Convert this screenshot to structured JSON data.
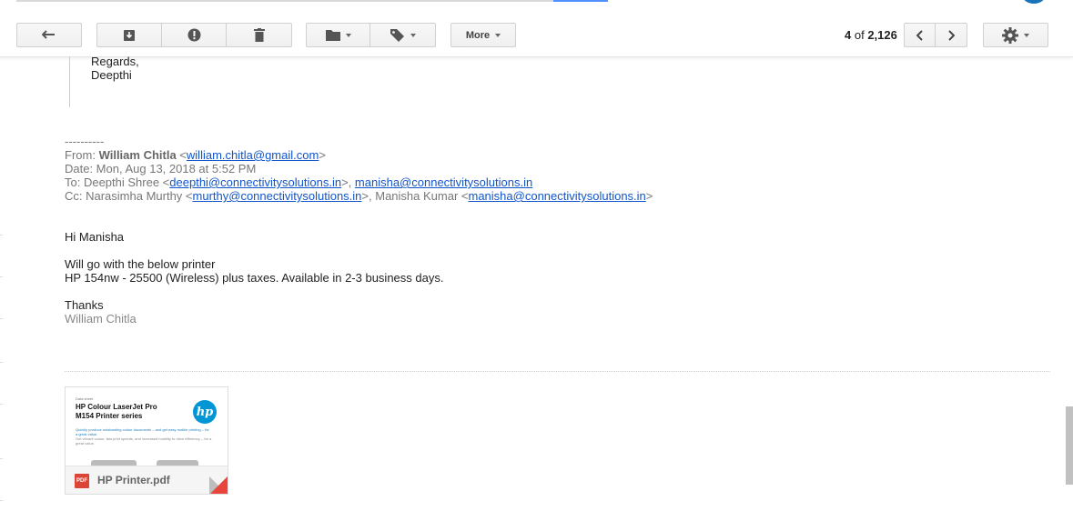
{
  "toolbar": {
    "buttons": {
      "back": "back-arrow-icon",
      "archive": "archive-icon",
      "spam": "report-spam-icon",
      "delete": "trash-icon",
      "move": "folder-icon",
      "labels": "label-tag-icon",
      "settings": "gear-icon"
    },
    "more_label": "More",
    "counter": {
      "current": "4",
      "of_text": "of",
      "total": "2,126"
    }
  },
  "quoted": {
    "lines": [
      "Regards,",
      "Deepthi"
    ]
  },
  "forwarded": {
    "separator": "----------",
    "from_label": "From: ",
    "from_name": "William Chitla",
    "from_email": "william.chitla@gmail.com",
    "date_line": "Date: Mon, Aug 13, 2018 at 5:52 PM",
    "to_label": "To: Deepthi Shree <",
    "to_email1": "deepthi@connectivitysolutions.in",
    "to_email2": "manisha@connectivitysolutions.in",
    "cc_label": "Cc: Narasimha Murthy <",
    "cc_email1": "murthy@connectivitysolutions.in",
    "cc_name2": "Manisha Kumar",
    "cc_email2": "manisha@connectivitysolutions.in"
  },
  "body": {
    "greeting": "Hi Manisha",
    "line1": "Will go with the below printer",
    "line2": "HP 154nw - 25500 (Wireless) plus taxes. Available in 2-3 business days.",
    "closing": "Thanks",
    "signature": "William Chitla"
  },
  "attachment": {
    "filename": "HP Printer.pdf",
    "icon_text": "PDF",
    "preview": {
      "small_top": "Data sheet",
      "title_line1": "HP Colour LaserJet Pro",
      "title_line2": "M154 Printer series",
      "subtitle": "Quickly produce outstanding colour documents – and get easy mobile printing – for a great value.",
      "body": "Get vibrant colour, fast print speeds, and increased mobility to drive efficiency – for a great value.",
      "logo": "hp"
    }
  },
  "colors": {
    "link": "#1155cc",
    "pdf_red": "#db4437",
    "hp_blue": "#0096d6"
  }
}
